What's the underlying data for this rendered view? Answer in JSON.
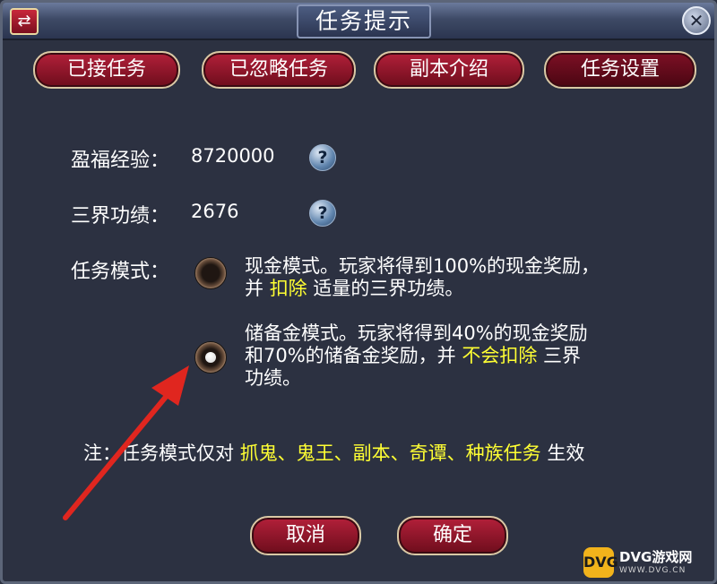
{
  "window": {
    "title": "任务提示"
  },
  "tabs": [
    {
      "label": "已接任务"
    },
    {
      "label": "已忽略任务"
    },
    {
      "label": "副本介绍"
    },
    {
      "label": "任务设置"
    }
  ],
  "stats": {
    "exp_label": "盈福经验：",
    "exp_value": "8720000",
    "merit_label": "三界功绩：",
    "merit_value": "2676"
  },
  "mode": {
    "label": "任务模式：",
    "selected": "储备金模式",
    "options": [
      {
        "line1": "现金模式。玩家将得到100%的现金奖励，",
        "line2_pre": "并 ",
        "line2_hl": "扣除",
        "line2_post": " 适量的三界功绩。"
      },
      {
        "line1": "储备金模式。玩家将得到40%的现金奖励",
        "line2_pre": "和70%的储备金奖励，并 ",
        "line2_hl": "不会扣除",
        "line2_post": " 三界",
        "line3": "功绩。"
      }
    ]
  },
  "note": {
    "prefix": "注：任务模式仅对 ",
    "items_hl": "抓鬼、鬼王、副本、奇谭、种族任务",
    "suffix": " 生效"
  },
  "buttons": {
    "cancel": "取消",
    "confirm": "确定"
  },
  "icons": {
    "switch": "swap-icon",
    "close": "close-icon",
    "help": "question-icon"
  },
  "colors": {
    "highlight": "#ffff33",
    "button_red": "#9b1a30",
    "arrow": "#e0261f"
  },
  "watermark": {
    "logo": "DVG",
    "main": "DVG游戏网",
    "sub": "WWW.DVG.CN"
  }
}
